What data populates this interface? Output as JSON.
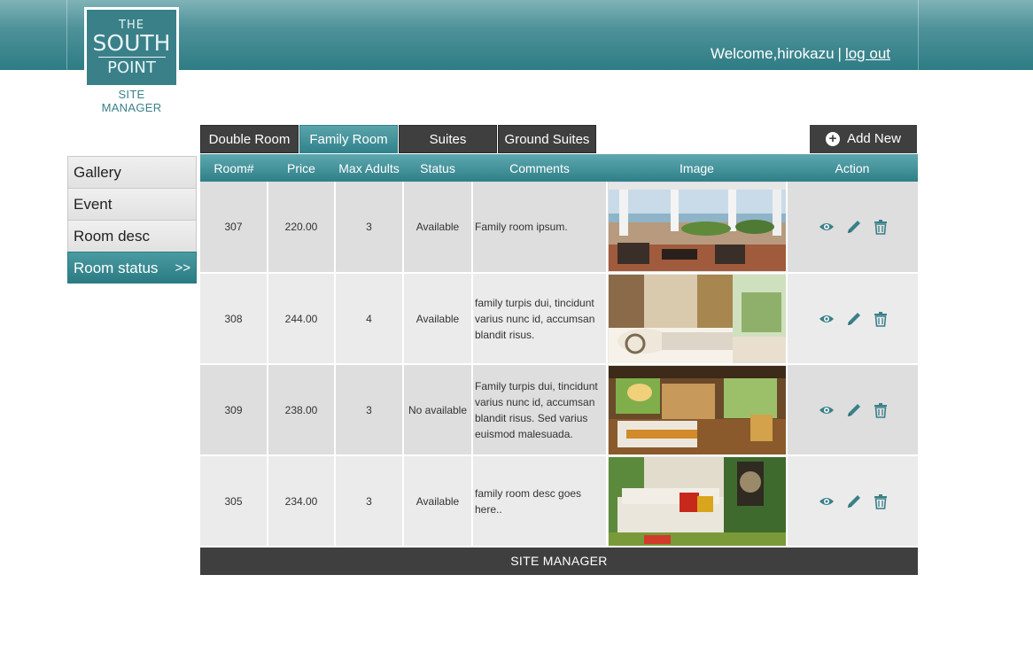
{
  "brand": {
    "logo_the": "THE",
    "logo_south": "SOUTH",
    "logo_point": "POINT",
    "subtitle": "SITE MANAGER"
  },
  "header": {
    "welcome": "Welcome,hirokazu",
    "separator": "|",
    "logout": "log out"
  },
  "sidebar": {
    "items": [
      {
        "label": "Gallery"
      },
      {
        "label": "Event"
      },
      {
        "label": "Room desc"
      },
      {
        "label": "Room status",
        "arrow": ">>",
        "active": true
      }
    ]
  },
  "tabs": [
    {
      "label": "Double Room"
    },
    {
      "label": "Family Room",
      "active": true
    },
    {
      "label": "Suites"
    },
    {
      "label": "Ground Suites"
    }
  ],
  "add_new": {
    "label": "Add New",
    "icon": "plus-circle-icon"
  },
  "table": {
    "columns": [
      "Room#",
      "Price",
      "Max Adults",
      "Status",
      "Comments",
      "Image",
      "Action"
    ],
    "rows": [
      {
        "room": "307",
        "price": "220.00",
        "max_adults": "3",
        "status": "Available",
        "comment": "Family room ipsum.",
        "image": "terrace-seating-sea-view"
      },
      {
        "room": "308",
        "price": "244.00",
        "max_adults": "4",
        "status": "Available",
        "comment": "family turpis dui, tincidunt varius nunc id, accumsan blandit risus.",
        "image": "bedroom-curtains-balcony"
      },
      {
        "room": "309",
        "price": "238.00",
        "max_adults": "3",
        "status": "No available",
        "comment": "Family turpis dui, tincidunt varius nunc id, accumsan blandit risus. Sed varius euismod malesuada.",
        "image": "bedroom-wood-interior"
      },
      {
        "room": "305",
        "price": "234.00",
        "max_adults": "3",
        "status": "Available",
        "comment": "family room desc goes here..",
        "image": "sofa-red-cushions"
      }
    ],
    "action_icons": [
      "eye-icon",
      "pencil-icon",
      "trash-icon"
    ]
  },
  "footer": {
    "label": "SITE MANAGER"
  },
  "colors": {
    "accent": "#3a8089",
    "dark": "#3f3f3f"
  }
}
